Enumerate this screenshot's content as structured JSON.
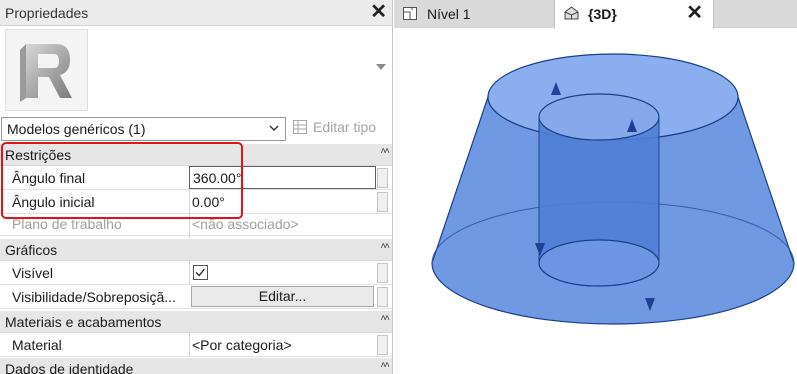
{
  "properties_panel": {
    "title": "Propriedades",
    "type_selector": {
      "value": "Modelos genéricos (1)"
    },
    "edit_type_label": "Editar tipo",
    "categories": {
      "restricoes": "Restrições",
      "graficos": "Gráficos",
      "materiais": "Materiais e acabamentos",
      "dados": "Dados de identidade"
    },
    "rows": {
      "angulo_final": {
        "name": "Ângulo final",
        "value": "360.00°"
      },
      "angulo_inicial": {
        "name": "Ângulo inicial",
        "value": "0.00°"
      },
      "plano": {
        "name": "Plano de trabalho",
        "value": "<não associado>"
      },
      "visivel": {
        "name": "Visível",
        "checked": true
      },
      "visibilidade": {
        "name": "Visibilidade/Sobreposiçã...",
        "button": "Editar..."
      },
      "material": {
        "name": "Material",
        "value": "<Por categoria>"
      }
    }
  },
  "view_tabs": [
    {
      "label": "Nível 1",
      "icon": "floor-plan-icon"
    },
    {
      "label": "{3D}",
      "icon": "house-3d-icon"
    }
  ],
  "colors": {
    "highlight": "#e0131b",
    "solid_fill": "#6f99e3",
    "solid_edge": "#1a3f8a"
  }
}
